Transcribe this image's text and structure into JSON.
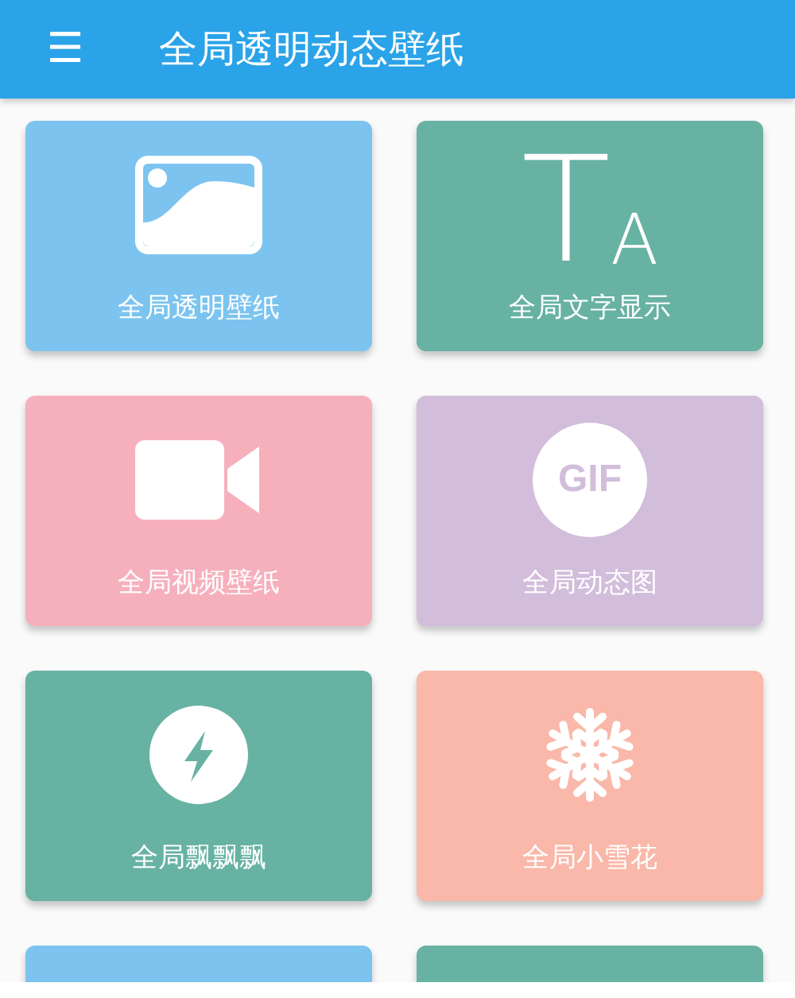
{
  "app_bar": {
    "menu_icon": "☰",
    "title": "全局透明动态壁纸"
  },
  "tile_rows": [
    {
      "tiles": [
        {
          "kind": "image",
          "label": "全局透明壁纸",
          "color": "#7cc4ef"
        },
        {
          "kind": "letters",
          "label": "全局文字显示",
          "icon_text": [
            "T",
            "A"
          ],
          "color": "#67b2a3"
        }
      ]
    },
    {
      "tiles": [
        {
          "kind": "video",
          "label": "全局视频壁纸",
          "color": "#f6b0bc"
        },
        {
          "kind": "gif",
          "label": "全局动态图",
          "icon_text": [
            "GIF"
          ],
          "color": "#d2bddb"
        }
      ]
    },
    {
      "tiles": [
        {
          "kind": "bolt",
          "label": "全局飘飘飘",
          "color": "#67b2a3"
        },
        {
          "kind": "snowflake",
          "label": "全局小雪花",
          "color": "#f9b8a9"
        }
      ]
    },
    {
      "tiles": [
        {
          "kind": "blank",
          "color": "#7cc4ef"
        },
        {
          "kind": "blank",
          "color": "#67b2a3"
        }
      ]
    }
  ]
}
